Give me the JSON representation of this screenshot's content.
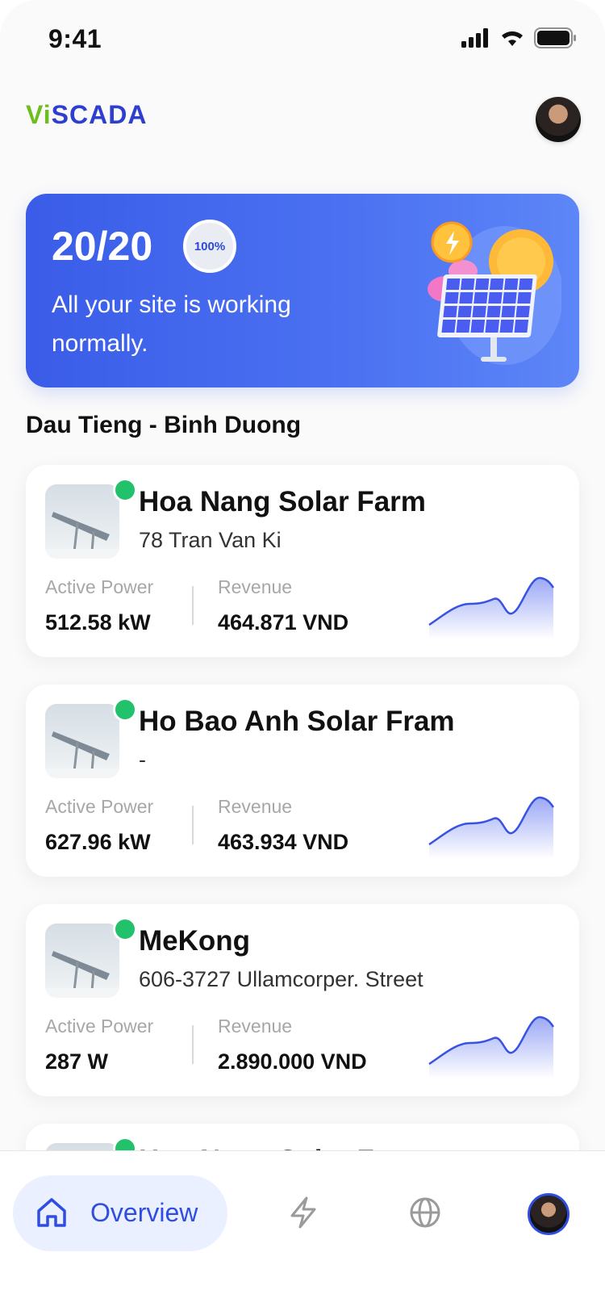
{
  "status_bar": {
    "time": "9:41"
  },
  "header": {
    "logo_v": "Vi",
    "logo_rest": "SCADA"
  },
  "summary": {
    "count": "20/20",
    "percent": "100%",
    "message": "All your site is working normally."
  },
  "section": {
    "title": "Dau Tieng - Binh Duong"
  },
  "labels": {
    "active_power": "Active Power",
    "revenue": "Revenue"
  },
  "sites": [
    {
      "name": "Hoa Nang Solar Farm",
      "address": "78 Tran Van Ki",
      "active_power": "512.58 kW",
      "revenue": "464.871 VND",
      "status": "online"
    },
    {
      "name": "Ho Bao Anh Solar Fram",
      "address": "-",
      "active_power": "627.96 kW",
      "revenue": "463.934 VND",
      "status": "online"
    },
    {
      "name": "MeKong",
      "address": "606-3727 Ullamcorper. Street",
      "active_power": "287 W",
      "revenue": "2.890.000 VND",
      "status": "online"
    },
    {
      "name": "Hoa Nang Solar Farm",
      "address": "",
      "active_power": "",
      "revenue": "",
      "status": "online"
    }
  ],
  "nav": {
    "overview_label": "Overview",
    "active_tab": "overview"
  },
  "icons": [
    "home-icon",
    "lightning-icon",
    "globe-icon",
    "profile-avatar"
  ],
  "colors": {
    "accent": "#2f4ee0",
    "online": "#22c16b",
    "logo_green": "#6dbe1f",
    "logo_blue": "#2e3fd0"
  }
}
